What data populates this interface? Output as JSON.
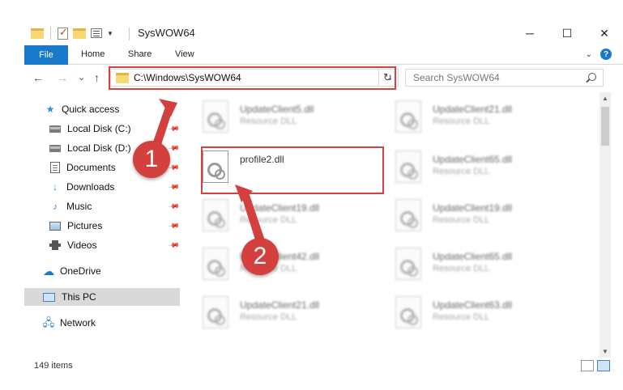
{
  "window": {
    "title": "SysWOW64",
    "minimize_glyph": "─",
    "maximize_glyph": "☐",
    "close_glyph": "✕"
  },
  "ribbon": {
    "tabs": [
      "File",
      "Home",
      "Share",
      "View"
    ],
    "help_label": "?"
  },
  "nav": {
    "back_glyph": "←",
    "forward_glyph": "→",
    "recent_glyph": "⌄",
    "up_glyph": "↑",
    "address": "C:\\Windows\\SysWOW64",
    "refresh_glyph": "↻",
    "search_placeholder": "Search SysWOW64"
  },
  "sidebar": {
    "items": [
      {
        "label": "Quick access",
        "icon": "star-icon",
        "pinned": false
      },
      {
        "label": "Local Disk (C:)",
        "icon": "drive-icon",
        "pinned": true
      },
      {
        "label": "Local Disk (D:)",
        "icon": "drive-icon",
        "pinned": true
      },
      {
        "label": "Documents",
        "icon": "document-icon",
        "pinned": true
      },
      {
        "label": "Downloads",
        "icon": "download-icon",
        "pinned": true
      },
      {
        "label": "Music",
        "icon": "music-icon",
        "pinned": true
      },
      {
        "label": "Pictures",
        "icon": "picture-icon",
        "pinned": true
      },
      {
        "label": "Videos",
        "icon": "video-icon",
        "pinned": true
      },
      {
        "label": "OneDrive",
        "icon": "cloud-icon",
        "pinned": false
      },
      {
        "label": "This PC",
        "icon": "computer-icon",
        "pinned": false,
        "selected": true
      },
      {
        "label": "Network",
        "icon": "network-icon",
        "pinned": false
      }
    ]
  },
  "files": {
    "left_column": [
      {
        "name": "UpdateClient5.dll",
        "type": "Resource DLL"
      },
      {
        "name": "profile2.dll",
        "type": ""
      },
      {
        "name": "UpdateClient19.dll",
        "type": "Resource DLL"
      },
      {
        "name": "UpdateClient42.dll",
        "type": "Resource DLL"
      },
      {
        "name": "UpdateClient21.dll",
        "type": "Resource DLL"
      }
    ],
    "right_column": [
      {
        "name": "UpdateClient21.dll",
        "type": "Resource DLL"
      },
      {
        "name": "UpdateClient65.dll",
        "type": "Resource DLL"
      },
      {
        "name": "UpdateClient19.dll",
        "type": "Resource DLL"
      },
      {
        "name": "UpdateClient65.dll",
        "type": "Resource DLL"
      },
      {
        "name": "UpdateClient63.dll",
        "type": "Resource DLL"
      }
    ]
  },
  "status": {
    "item_count": "149 items"
  },
  "callouts": {
    "step1": "1",
    "step2": "2",
    "color": "#d3403e"
  },
  "colors": {
    "accent": "#1979ca",
    "highlight_box": "#d24243",
    "selected_nav": "#d9d9d9"
  }
}
